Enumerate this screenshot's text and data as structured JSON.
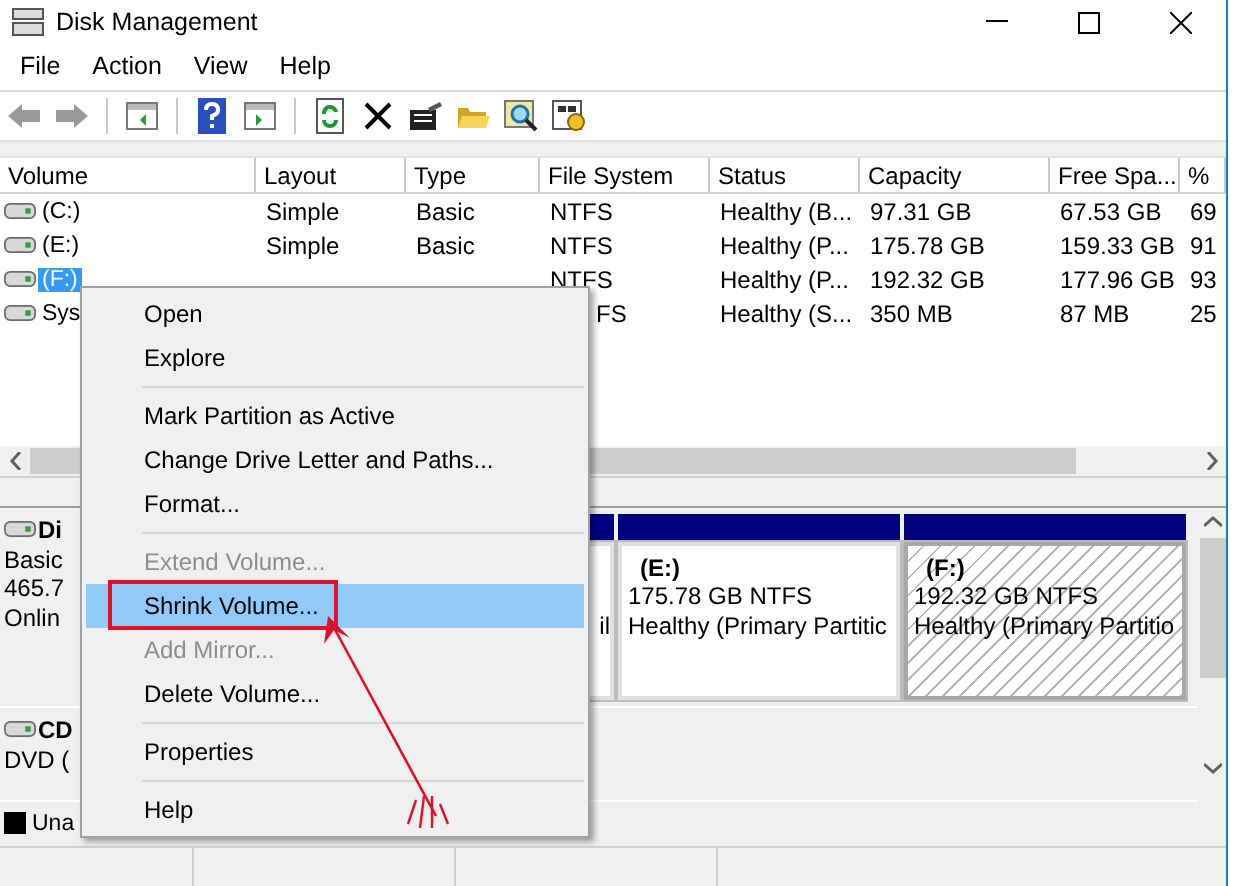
{
  "window": {
    "title": "Disk Management"
  },
  "menu": [
    "File",
    "Action",
    "View",
    "Help"
  ],
  "table": {
    "columns": [
      "Volume",
      "Layout",
      "Type",
      "File System",
      "Status",
      "Capacity",
      "Free Spa...",
      "%"
    ],
    "rows": [
      {
        "cells": [
          "(C:)",
          "Simple",
          "Basic",
          "NTFS",
          "Healthy (B...",
          "97.31 GB",
          "67.53 GB",
          "69"
        ],
        "selected": false
      },
      {
        "cells": [
          "(E:)",
          "Simple",
          "Basic",
          "NTFS",
          "Healthy (P...",
          "175.78 GB",
          "159.33 GB",
          "91"
        ],
        "selected": false
      },
      {
        "cells": [
          "(F:)",
          null,
          null,
          "NTFS",
          "Healthy (P...",
          "192.32 GB",
          "177.96 GB",
          "93"
        ],
        "selected": true
      },
      {
        "cells": [
          "Sys",
          null,
          null,
          "FS",
          "Healthy (S...",
          "350 MB",
          "87 MB",
          "25"
        ],
        "selected": false
      }
    ]
  },
  "disks": [
    {
      "name": "Di",
      "lines": [
        "Basic",
        "465.7",
        "Onlin"
      ],
      "partitions": [
        {
          "kind": "clipped",
          "status": "il"
        },
        {
          "kind": "full",
          "name": "(E:)",
          "size": "175.78 GB NTFS",
          "status": "Healthy (Primary Partitic",
          "selected": false
        },
        {
          "kind": "full",
          "name": "(F:)",
          "size": "192.32 GB NTFS",
          "status": "Healthy (Primary Partitio",
          "selected": true
        }
      ]
    },
    {
      "name": "CD",
      "lines": [
        "DVD ("
      ]
    }
  ],
  "legend": [
    {
      "label": "Una",
      "color": "#000000"
    }
  ],
  "context_menu": [
    {
      "kind": "item",
      "label": "Open",
      "disabled": false,
      "selected": false
    },
    {
      "kind": "item",
      "label": "Explore",
      "disabled": false,
      "selected": false
    },
    {
      "kind": "separator"
    },
    {
      "kind": "item",
      "label": "Mark Partition as Active",
      "disabled": false,
      "selected": false
    },
    {
      "kind": "item",
      "label": "Change Drive Letter and Paths...",
      "disabled": false,
      "selected": false
    },
    {
      "kind": "item",
      "label": "Format...",
      "disabled": false,
      "selected": false
    },
    {
      "kind": "separator"
    },
    {
      "kind": "item",
      "label": "Extend Volume...",
      "disabled": true,
      "selected": false
    },
    {
      "kind": "item",
      "label": "Shrink Volume...",
      "disabled": false,
      "selected": true
    },
    {
      "kind": "item",
      "label": "Add Mirror...",
      "disabled": true,
      "selected": false
    },
    {
      "kind": "item",
      "label": "Delete Volume...",
      "disabled": false,
      "selected": false
    },
    {
      "kind": "separator"
    },
    {
      "kind": "item",
      "label": "Properties",
      "disabled": false,
      "selected": false
    },
    {
      "kind": "separator"
    },
    {
      "kind": "item",
      "label": "Help",
      "disabled": false,
      "selected": false
    }
  ]
}
